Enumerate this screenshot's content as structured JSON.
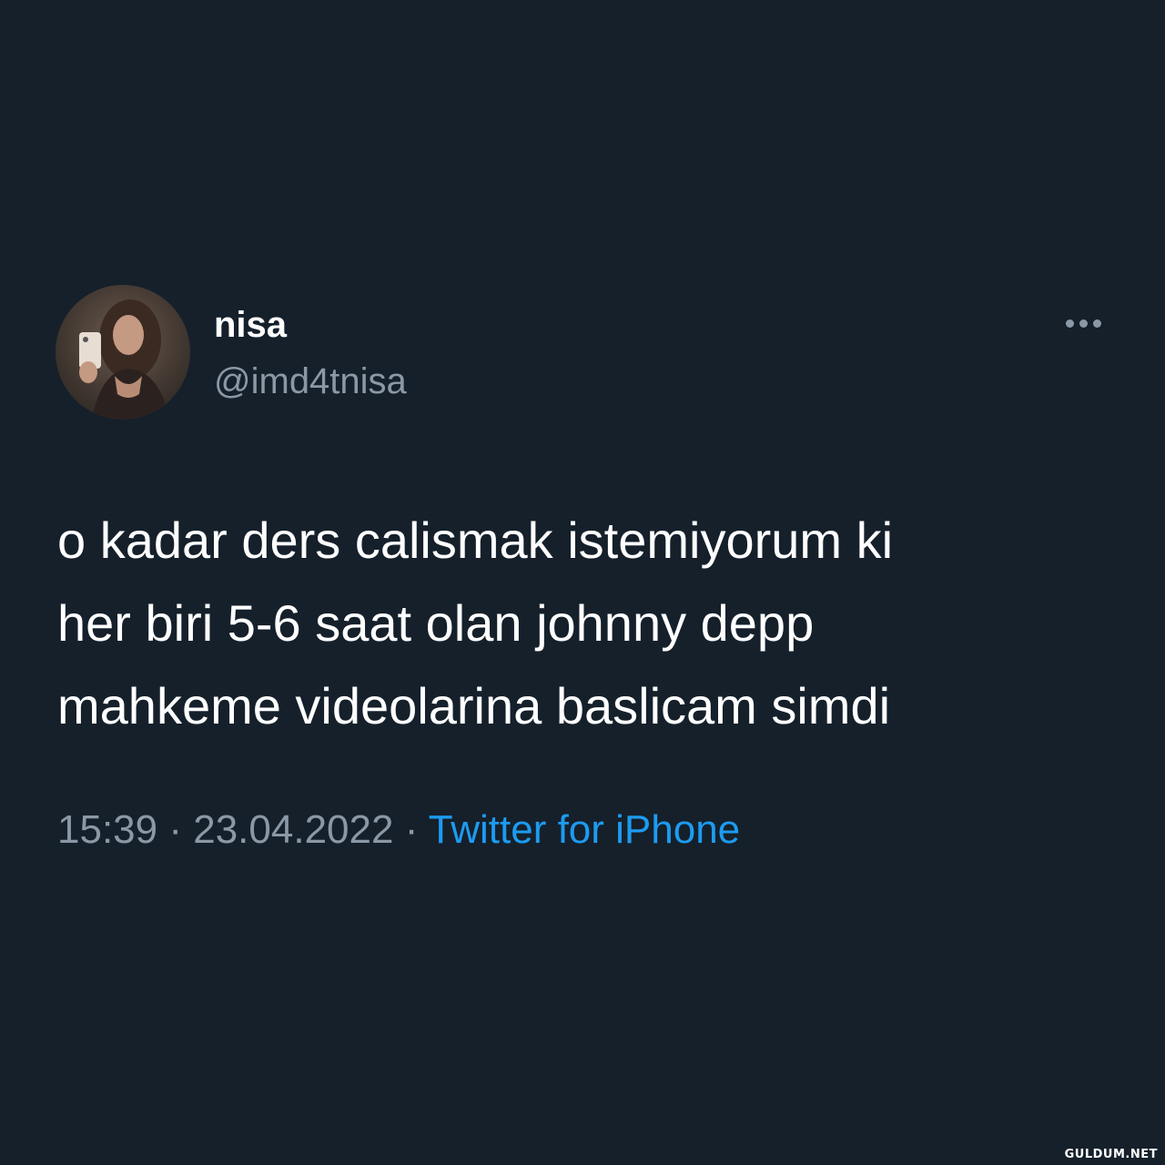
{
  "tweet": {
    "display_name": "nisa",
    "handle": "@imd4tnisa",
    "text_lines": [
      "o kadar ders calismak istemiyorum ki",
      "her biri 5-6 saat olan johnny depp",
      "mahkeme videolarina baslicam simdi"
    ],
    "time": "15:39",
    "separator": "·",
    "date": "23.04.2022",
    "source": "Twitter for iPhone"
  },
  "icons": {
    "more": "more-horizontal-icon",
    "avatar": "profile-photo"
  },
  "watermark": "GULDUM.NET",
  "colors": {
    "background": "#15202b",
    "primary_text": "#ffffff",
    "secondary_text": "#8b98a5",
    "accent": "#1d9bf0"
  }
}
